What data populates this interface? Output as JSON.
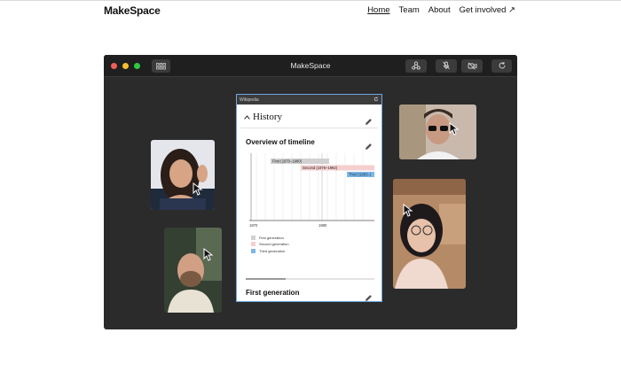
{
  "site": {
    "brand": "MakeSpace",
    "nav": [
      {
        "label": "Home",
        "active": true
      },
      {
        "label": "Team",
        "active": false
      },
      {
        "label": "About",
        "active": false
      },
      {
        "label": "Get involved ↗",
        "active": false
      }
    ]
  },
  "app_window": {
    "title": "MakeSpace",
    "toolbar_icons": [
      "grid-icon",
      "share-icon",
      "mic-off-icon",
      "video-off-icon",
      "refresh-icon"
    ]
  },
  "wiki_panel": {
    "source_label": "Wikipedia",
    "section_title": "History",
    "subsection_title": "Overview of timeline",
    "next_heading": "First generation",
    "timeline": {
      "bars": [
        {
          "label": "First (1970–1980)",
          "color": "#d0d0d0"
        },
        {
          "label": "Second (1975–1992)",
          "color": "#f5cfcf"
        },
        {
          "label": "Third (1983–)",
          "color": "#7bb6e6"
        }
      ],
      "axis_ticks": [
        "1970",
        "1980"
      ]
    },
    "legend": [
      "First generation",
      "Second generation",
      "Third generation"
    ]
  },
  "colors": {
    "window_bg": "#2b2b2b",
    "titlebar_bg": "#1f1f1f",
    "panel_border": "#6ea6e0"
  }
}
